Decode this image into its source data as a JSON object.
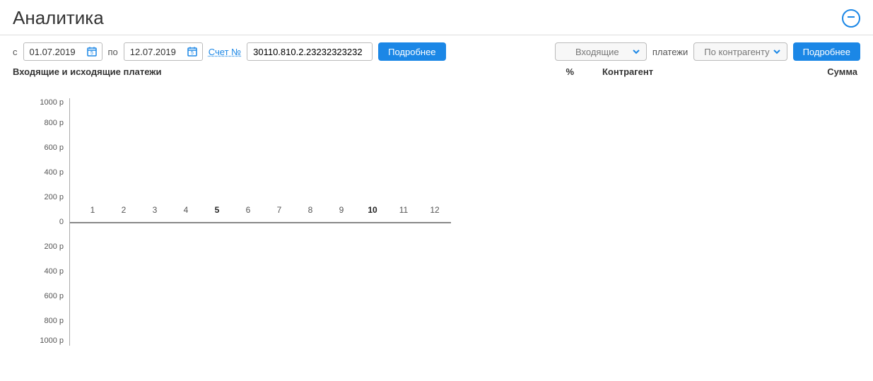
{
  "header": {
    "title": "Аналитика"
  },
  "filters": {
    "from_label": "с",
    "from_date": "01.07.2019",
    "to_label": "по",
    "to_date": "12.07.2019",
    "account_label": "Счет №",
    "account_value": "30110.810.2.23232323232",
    "details_btn": "Подробнее",
    "direction_select": "Входящие",
    "payments_label": "платежи",
    "group_select": "По контрагенту",
    "details_btn_right": "Подробнее"
  },
  "chart_title": "Входящие и исходящие платежи",
  "right_table": {
    "col_pct": "%",
    "col_counterparty": "Контрагент",
    "col_sum": "Сумма"
  },
  "chart_data": {
    "type": "bar",
    "title": "Входящие и исходящие платежи",
    "xlabel": "",
    "ylabel": "",
    "y_ticks_pos": [
      "1000 р",
      "800 р",
      "600 р",
      "400 р",
      "200 р",
      "0"
    ],
    "y_ticks_neg": [
      "200 р",
      "400 р",
      "600 р",
      "800 р",
      "1000 р"
    ],
    "ylim": [
      -1000,
      1000
    ],
    "categories": [
      "1",
      "2",
      "3",
      "4",
      "5",
      "6",
      "7",
      "8",
      "9",
      "10",
      "11",
      "12"
    ],
    "highlighted_x": [
      5,
      10
    ],
    "series": [
      {
        "name": "Входящие",
        "values": [
          0,
          0,
          0,
          0,
          0,
          0,
          0,
          0,
          0,
          0,
          0,
          0
        ]
      },
      {
        "name": "Исходящие",
        "values": [
          0,
          0,
          0,
          0,
          0,
          0,
          0,
          0,
          0,
          0,
          0,
          0
        ]
      }
    ]
  }
}
